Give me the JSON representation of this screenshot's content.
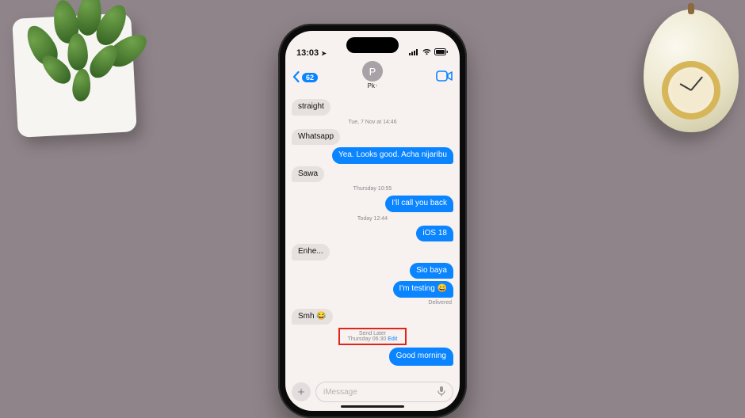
{
  "status": {
    "time": "13:03",
    "location_glyph": "➤"
  },
  "header": {
    "back_count": "62",
    "contact_initial": "P",
    "contact_name": "Pk"
  },
  "timestamps": {
    "t1": "Tue, 7 Nov at 14:46",
    "t2": "Thursday 10:55",
    "t3": "Today 12:44"
  },
  "messages": {
    "m_straight": "straight",
    "m_whatsapp": "Whatsapp",
    "m_yea": "Yea. Looks good. Acha nijaribu",
    "m_sawa": "Sawa",
    "m_callback": "I'll call you back",
    "m_ios18": "iOS 18",
    "m_enhe": "Enhe...",
    "m_siobaya": "Sio baya",
    "m_testing": "I'm testing 😄",
    "m_smh": "Smh 😂",
    "m_goodmorning": "Good morning"
  },
  "delivered_label": "Delivered",
  "send_later": {
    "title": "Send Later",
    "when": "Thursday 06:30",
    "edit": "Edit"
  },
  "composer": {
    "placeholder": "iMessage"
  }
}
